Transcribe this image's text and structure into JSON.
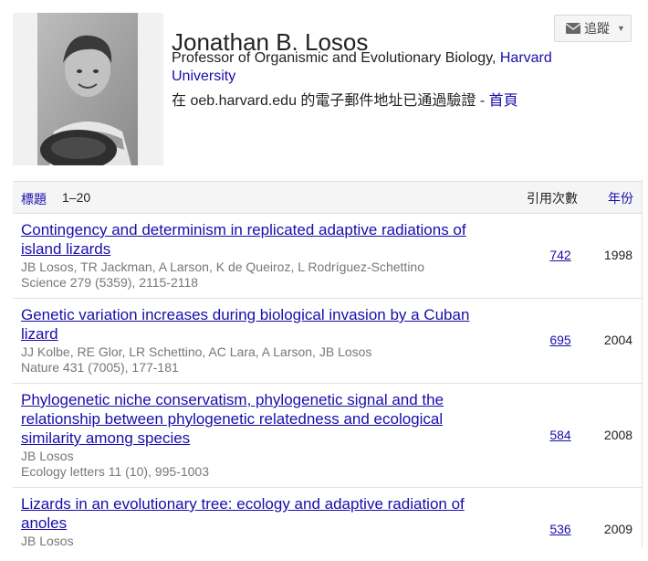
{
  "profile": {
    "name": "Jonathan B. Losos",
    "affiliation_prefix": "Professor of Organismic and Evolutionary Biology, ",
    "affiliation_link": "Harvard University",
    "verified_text": "在 oeb.harvard.edu 的電子郵件地址已通過驗證 - ",
    "homepage_link": "首頁",
    "follow_label": "追蹤",
    "follow_icon": "mail-icon"
  },
  "table": {
    "title_header": "標題",
    "range": "1–20",
    "cited_header": "引用次數",
    "year_header": "年份"
  },
  "articles": [
    {
      "title": "Contingency and determinism in replicated adaptive radiations of island lizards",
      "authors": "JB Losos, TR Jackman, A Larson, K de Queiroz, L Rodríguez-Schettino",
      "venue": "Science 279 (5359), 2115-2118",
      "cited": "742",
      "year": "1998"
    },
    {
      "title": "Genetic variation increases during biological invasion by a Cuban lizard",
      "authors": "JJ Kolbe, RE Glor, LR Schettino, AC Lara, A Larson, JB Losos",
      "venue": "Nature 431 (7005), 177-181",
      "cited": "695",
      "year": "2004"
    },
    {
      "title": "Phylogenetic niche conservatism, phylogenetic signal and the relationship between phylogenetic relatedness and ecological similarity among species",
      "authors": "JB Losos",
      "venue": "Ecology letters 11 (10), 995-1003",
      "cited": "584",
      "year": "2008"
    },
    {
      "title": "Lizards in an evolutionary tree: ecology and adaptive radiation of anoles",
      "authors": "JB Losos",
      "venue": "",
      "cited": "536",
      "year": "2009"
    }
  ]
}
